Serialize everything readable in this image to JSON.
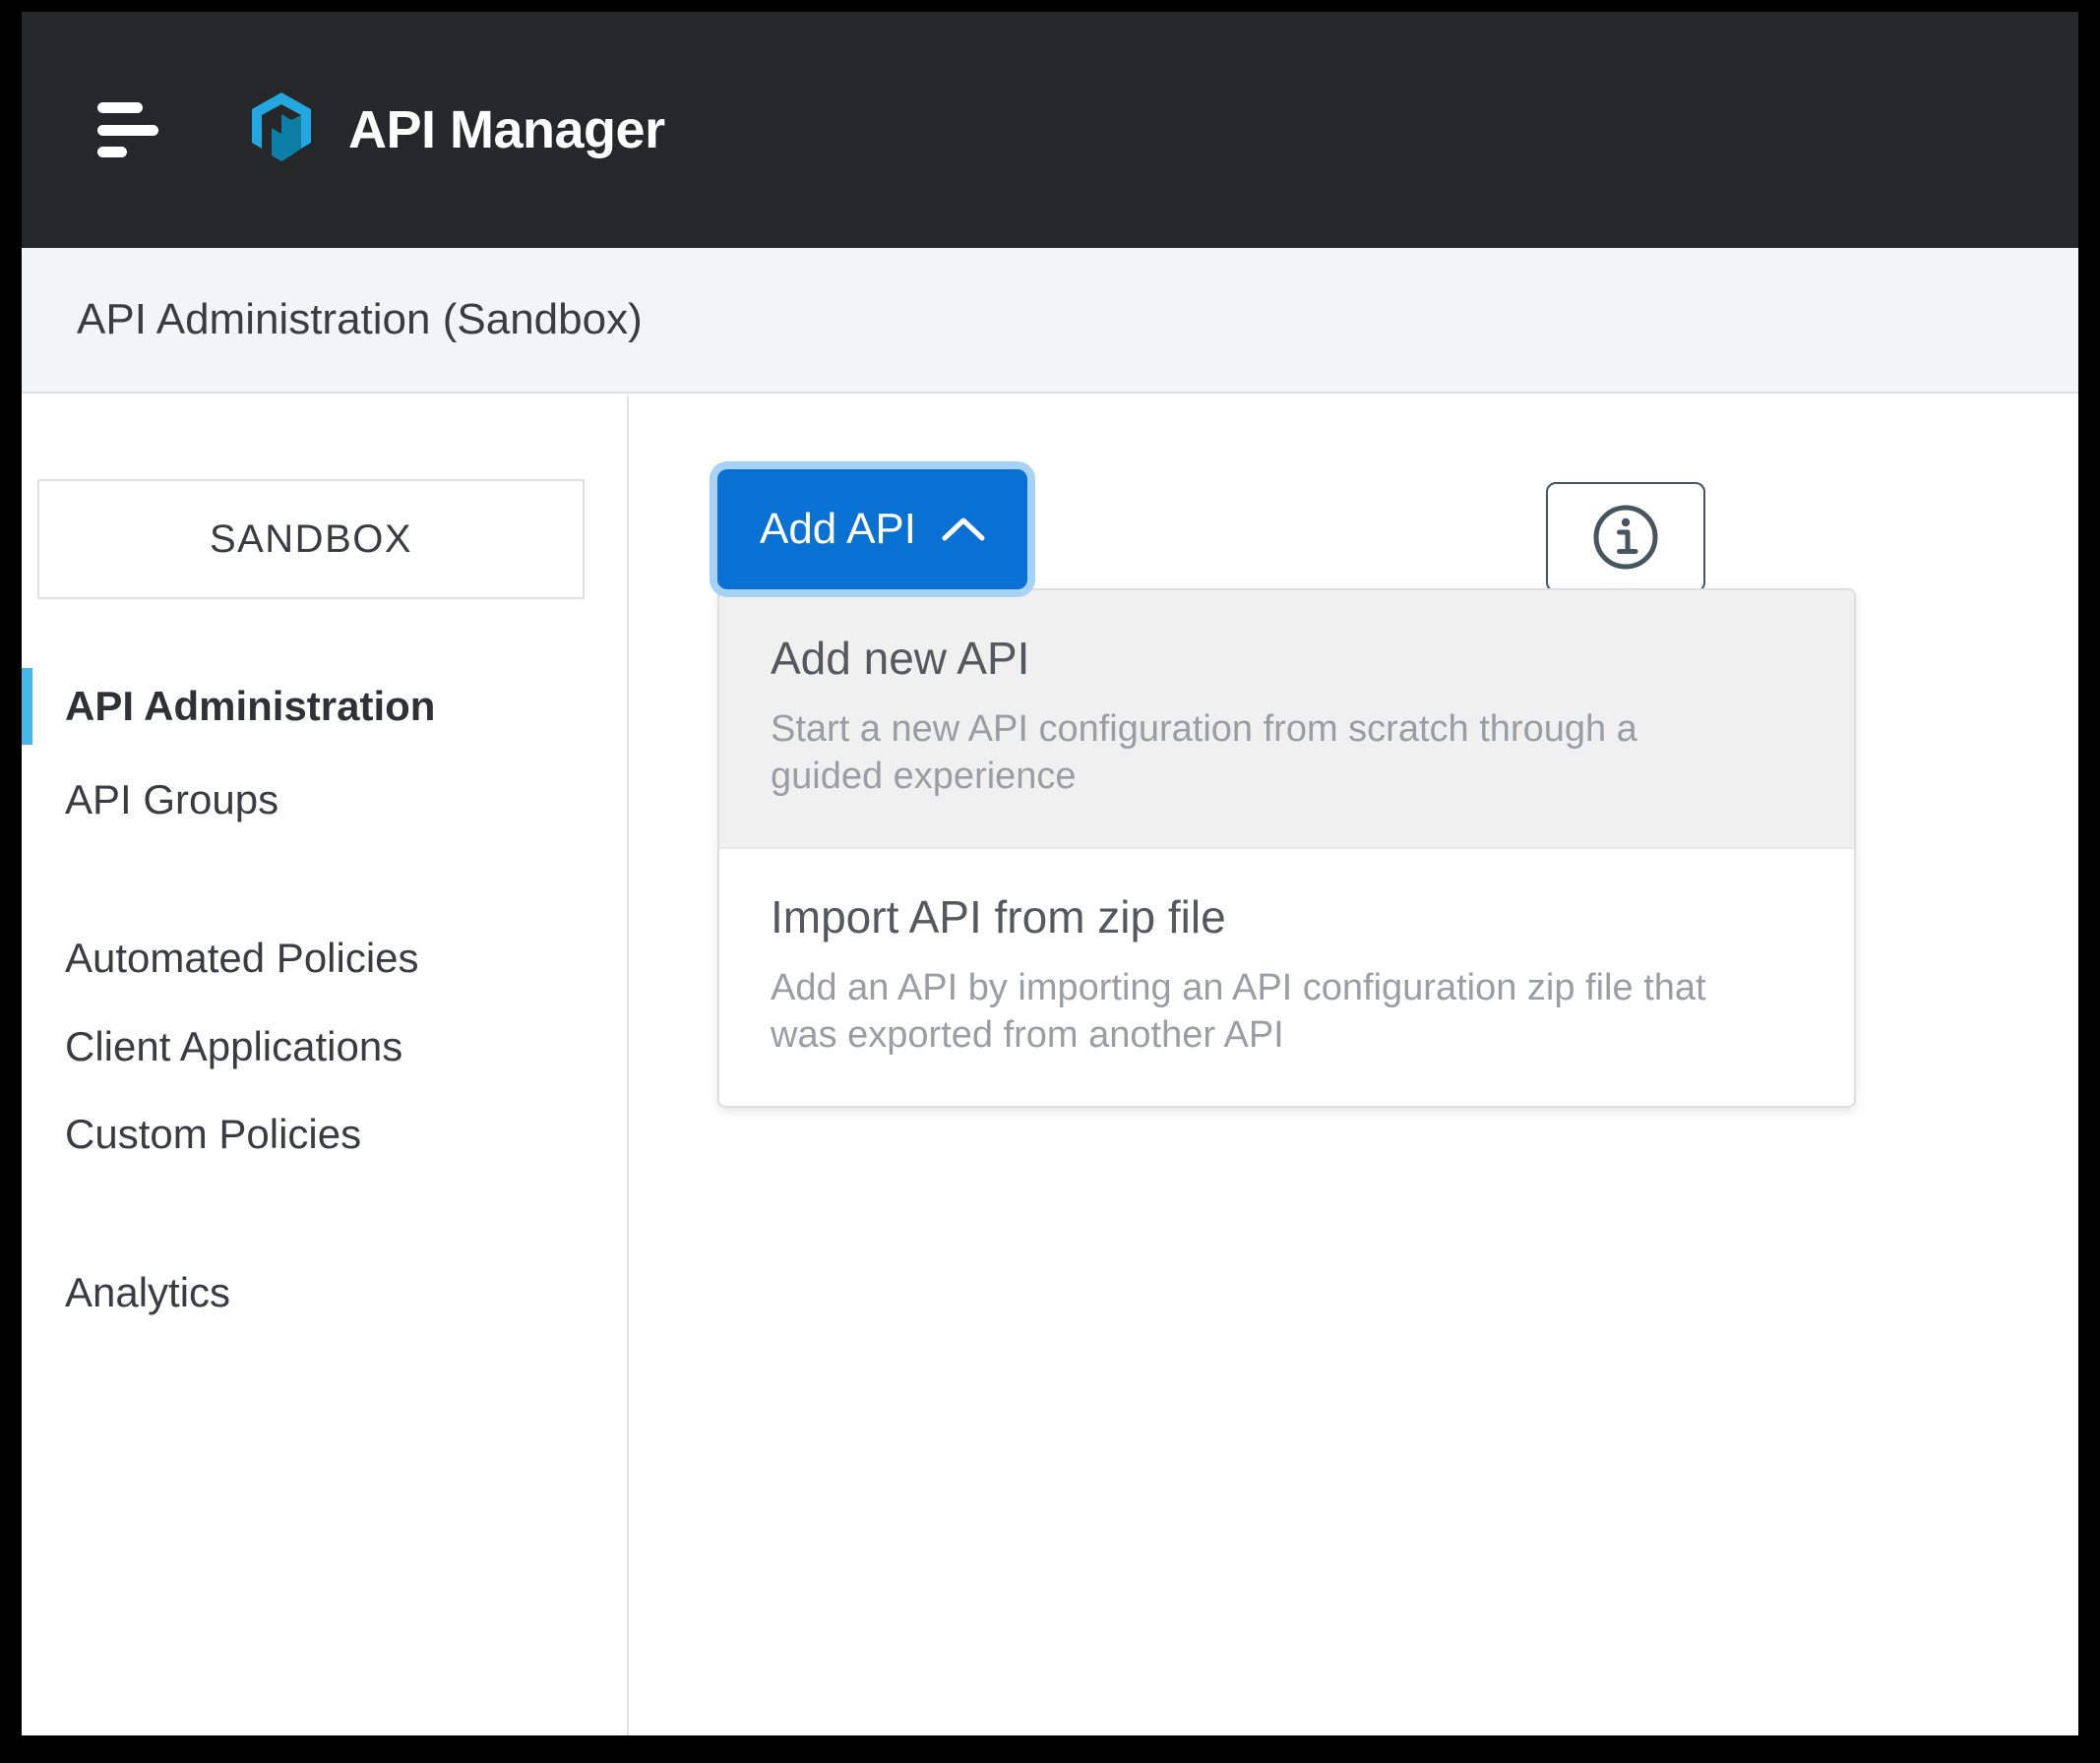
{
  "header": {
    "menu_icon": "hamburger-menu-icon",
    "logo_icon": "hexagon-n-logo",
    "title": "API Manager",
    "background_color": "#262729"
  },
  "page": {
    "title": "API Administration (Sandbox)",
    "background_color": "#f3f4f6"
  },
  "sidebar": {
    "environment_selector": {
      "label": "SANDBOX"
    },
    "active_indicator_color": "#47b7ea",
    "items": [
      {
        "label": "API Administration",
        "active": true
      },
      {
        "label": "API Groups",
        "active": false
      },
      {
        "label": "Automated Policies",
        "active": false
      },
      {
        "label": "Client Applications",
        "active": false
      },
      {
        "label": "Custom Policies",
        "active": false
      },
      {
        "label": "Analytics",
        "active": false
      }
    ]
  },
  "main": {
    "add_api_button": {
      "label": "Add API",
      "caret_icon": "chevron-up-icon",
      "background_color": "#0a71d4",
      "focus_ring_color": "#a8d2f5",
      "expanded": true
    },
    "info_button": {
      "icon": "info-circle-icon",
      "border_color": "#47555f"
    },
    "add_api_menu": {
      "items": [
        {
          "title": "Add new API",
          "description": "Start a new API configuration from scratch through a guided experience",
          "hovered": true
        },
        {
          "title": "Import API from zip file",
          "description": "Add an API by importing an API configuration zip file that was exported from another API",
          "hovered": false
        }
      ]
    }
  }
}
